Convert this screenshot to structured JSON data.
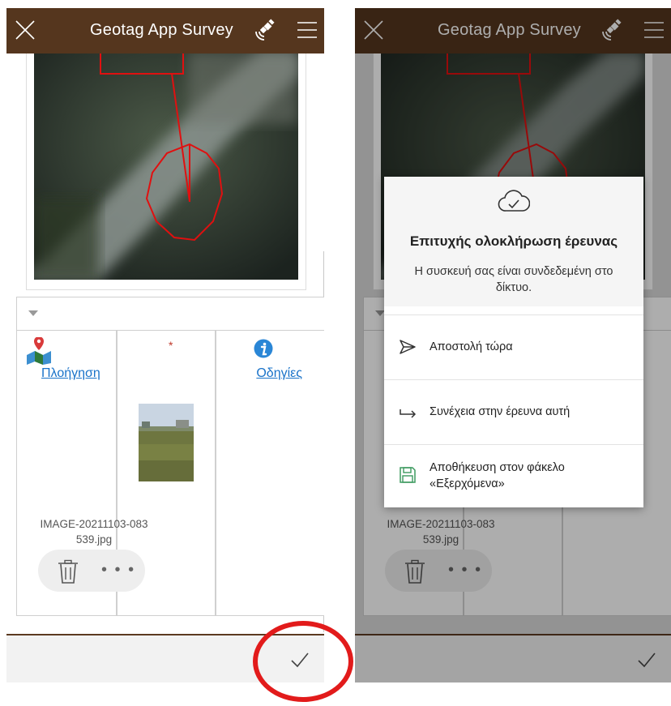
{
  "app": {
    "title": "Geotag App Survey"
  },
  "form": {
    "nav_link": "Πλοήγηση",
    "help_link": "Οδηγίες",
    "required_marker": "*",
    "attachment": {
      "filename_line1": "IMAGE-20211103-083",
      "filename_line2": "539.jpg"
    },
    "more_label": "• • •"
  },
  "dialog": {
    "title": "Επιτυχής ολοκλήρωση έρευνας",
    "subtitle": "Η συσκευή σας είναι συνδεδεμένη στο δίκτυο.",
    "options": [
      {
        "label": "Αποστολή τώρα",
        "icon": "send-icon"
      },
      {
        "label": "Συνέχεια στην έρευνα αυτή",
        "icon": "continue-arrow-icon"
      },
      {
        "label": "Αποθήκευση στον φάκελο «Εξερχόμενα»",
        "icon": "save-icon"
      }
    ]
  },
  "colors": {
    "appbar": "#55361e",
    "link": "#1a73c9",
    "highlight": "#e21b1b"
  }
}
